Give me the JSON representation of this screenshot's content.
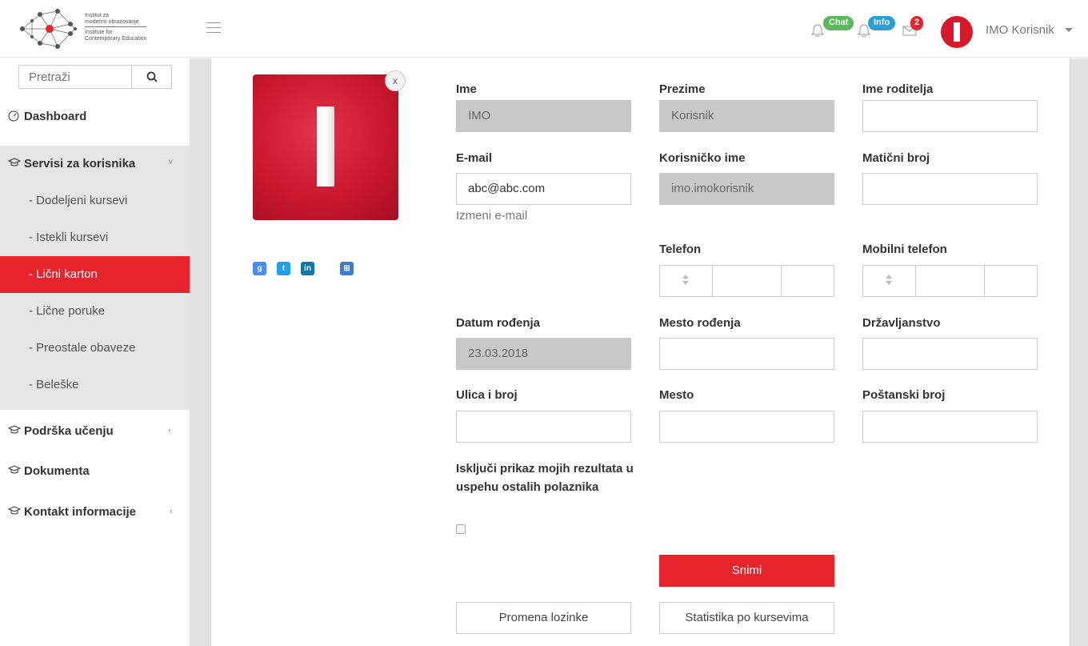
{
  "logo": {
    "line1": "Institut za",
    "line2": "moderno obrazovanje",
    "line3": "Institute for",
    "line4": "Contemporary Education"
  },
  "header": {
    "chat_label": "Chat",
    "info_label": "Info",
    "messages_count": "2",
    "user_name": "IMO Korisnik",
    "colors": {
      "chat": "#5cb85c",
      "info": "#2a9fd6",
      "messages": "#e8232c"
    }
  },
  "sidebar": {
    "search_placeholder": "Pretraži",
    "dashboard": "Dashboard",
    "services": "Servisi za korisnika",
    "sub_items": [
      "- Dodeljeni kursevi",
      "- Istekli kursevi",
      "- Lični karton",
      "- Lične poruke",
      "- Preostale obaveze",
      "- Beleške"
    ],
    "support": "Podrška učenju",
    "documents": "Dokumenta",
    "contact": "Kontakt informacije"
  },
  "form": {
    "labels": {
      "first_name": "Ime",
      "last_name": "Prezime",
      "parent_name": "Ime roditelja",
      "email": "E-mail",
      "username": "Korisničko ime",
      "id_number": "Matični broj",
      "phone": "Telefon",
      "mobile": "Mobilni telefon",
      "birth_date": "Datum rođenja",
      "birth_place": "Mesto rođenja",
      "citizenship": "Državljanstvo",
      "street": "Ulica i broj",
      "city": "Mesto",
      "postal": "Poštanski broj",
      "hide_results": "Isključi prikaz mojih rezultata u uspehu ostalih polaznika"
    },
    "values": {
      "first_name": "IMO",
      "last_name": "Korisnik",
      "email": "abc@abc.com",
      "username": "imo.imokorisnik",
      "birth_date": "23.03.2018"
    },
    "change_email": "Izmeni e-mail",
    "save": "Snimi",
    "change_password": "Promena lozinke",
    "stats": "Statistika po kursevima"
  },
  "profile": {
    "close": "x",
    "accent": "#d8182c"
  }
}
